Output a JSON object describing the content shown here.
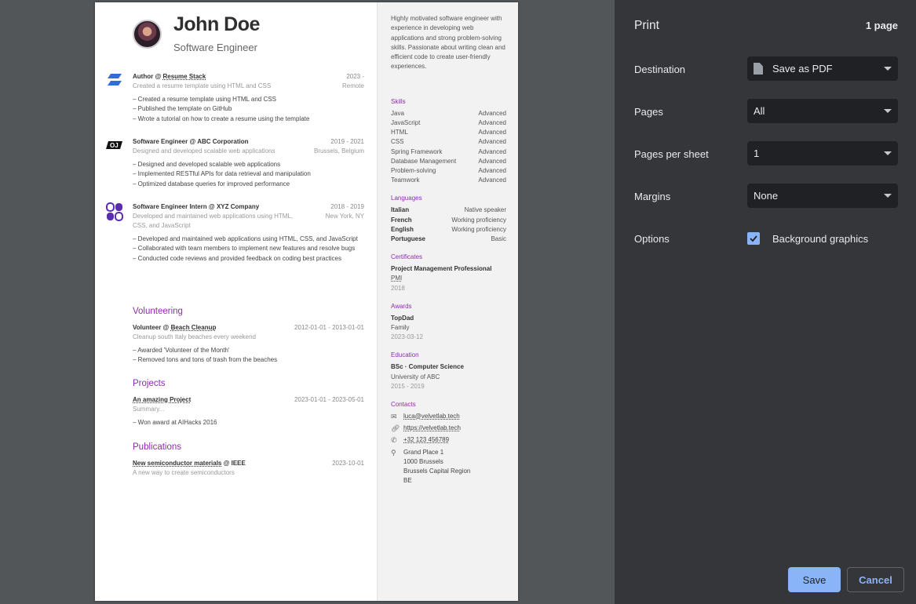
{
  "resume": {
    "name": "John Doe",
    "title": "Software Engineer",
    "work": [
      {
        "role": "Author",
        "company": "Resume Stack",
        "date": "2023 -",
        "summary": "Created a resume template using HTML and CSS",
        "location": "Remote",
        "highlights": [
          "Created a resume template using HTML and CSS",
          "Published the template on GitHub",
          "Wrote a tutorial on how to create a resume using the template"
        ]
      },
      {
        "role": "Software Engineer",
        "company": "ABC Corporation",
        "date": "2019 - 2021",
        "summary": "Designed and developed scalable web applications",
        "location": "Brussels, Belgium",
        "highlights": [
          "Designed and developed scalable web applications",
          "Implemented RESTful APIs for data retrieval and manipulation",
          "Optimized database queries for improved performance"
        ]
      },
      {
        "role": "Software Engineer Intern",
        "company": "XYZ Company",
        "date": "2018 - 2019",
        "summary": "Developed and maintained web applications using HTML, CSS, and JavaScript",
        "location": "New York, NY",
        "highlights": [
          "Developed and maintained web applications using HTML, CSS, and JavaScript",
          "Collaborated with team members to implement new features and resolve bugs",
          "Conducted code reviews and provided feedback on coding best practices"
        ]
      }
    ],
    "volunteering_heading": "Volunteering",
    "volunteering": {
      "role": "Volunteer",
      "org": "Beach Cleanup",
      "date": "2012-01-01 - 2013-01-01",
      "summary": "Cleanup south Italy beaches every weekend",
      "highlights": [
        "Awarded 'Volunteer of the Month'",
        "Removed tons and tons of trash from the beaches"
      ]
    },
    "projects_heading": "Projects",
    "project": {
      "name": "An amazing Project",
      "date": "2023-01-01 - 2023-05-01",
      "summary": "Summary...",
      "highlights": [
        "Won award at AIHacks 2016"
      ]
    },
    "publications_heading": "Publications",
    "publication": {
      "name": "New semiconductor materials",
      "publisher": "IEEE",
      "date": "2023-10-01",
      "summary": "A new way to create semiconductors"
    },
    "summary": "Highly motivated software engineer with experience in developing web applications and strong problem-solving skills. Passionate about writing clean and efficient code to create user-friendly experiences.",
    "skills_heading": "Skills",
    "skills": [
      {
        "name": "Java",
        "level": "Advanced"
      },
      {
        "name": "JavaScript",
        "level": "Advanced"
      },
      {
        "name": "HTML",
        "level": "Advanced"
      },
      {
        "name": "CSS",
        "level": "Advanced"
      },
      {
        "name": "Spring Framework",
        "level": "Advanced"
      },
      {
        "name": "Database Management",
        "level": "Advanced"
      },
      {
        "name": "Problem-solving",
        "level": "Advanced"
      },
      {
        "name": "Teamwork",
        "level": "Advanced"
      }
    ],
    "languages_heading": "Languages",
    "languages": [
      {
        "name": "Italian",
        "fluency": "Native speaker"
      },
      {
        "name": "French",
        "fluency": "Working proficiency"
      },
      {
        "name": "English",
        "fluency": "Working proficiency"
      },
      {
        "name": "Portuguese",
        "fluency": "Basic"
      }
    ],
    "certificates_heading": "Certificates",
    "certificate": {
      "name": "Project Management Professional",
      "issuer": "PMI",
      "date": "2018"
    },
    "awards_heading": "Awards",
    "award": {
      "title": "TopDad",
      "awarder": "Family",
      "date": "2023-03-12"
    },
    "education_heading": "Education",
    "education": {
      "degree": "BSc · Computer Science",
      "institution": "University of ABC",
      "date": "2015 - 2019"
    },
    "contacts_heading": "Contacts",
    "contacts": {
      "email": "luca@velvetlab.tech",
      "website": "https://velvetlab.tech",
      "phone": "+32 123 456789",
      "address_lines": [
        "Grand Place 1",
        "1000 Brussels",
        "Brussels Capital Region",
        "BE"
      ]
    }
  },
  "dialog": {
    "title": "Print",
    "page_count": "1 page",
    "destination_label": "Destination",
    "destination_value": "Save as PDF",
    "pages_label": "Pages",
    "pages_value": "All",
    "pps_label": "Pages per sheet",
    "pps_value": "1",
    "margins_label": "Margins",
    "margins_value": "None",
    "options_label": "Options",
    "background_graphics_label": "Background graphics",
    "background_graphics_checked": true,
    "save_label": "Save",
    "cancel_label": "Cancel"
  },
  "colors": {
    "accent": "#8e2bb0",
    "dialog_bg": "#35363a",
    "button_blue": "#8ab4f8"
  }
}
